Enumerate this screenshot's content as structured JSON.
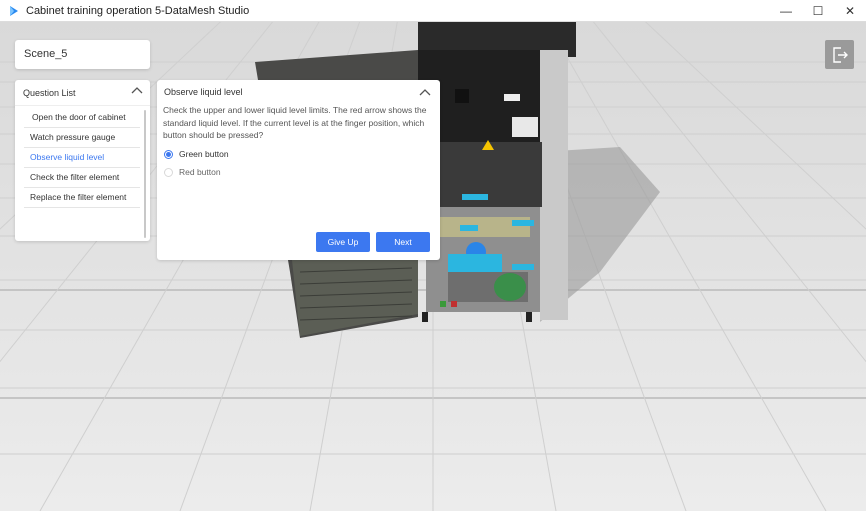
{
  "window": {
    "title": "Cabinet training operation 5-DataMesh Studio",
    "controls": [
      "minimize",
      "maximize",
      "close"
    ],
    "control_glyphs": {
      "minimize": "—",
      "maximize": "☐",
      "close": "✕"
    }
  },
  "scene": {
    "name": "Scene_5"
  },
  "question_list": {
    "title": "Question List",
    "items": [
      {
        "label": "Open the door of cabinet",
        "active": false
      },
      {
        "label": "Watch pressure gauge",
        "active": false
      },
      {
        "label": "Observe liquid level",
        "active": true
      },
      {
        "label": "Check the filter element",
        "active": false
      },
      {
        "label": "Replace the filter element",
        "active": false
      }
    ]
  },
  "question": {
    "title": "Observe liquid level",
    "text": "Check the upper and lower liquid level limits. The red arrow shows the standard liquid level. If the current level is at the finger position, which button should be pressed?",
    "options": [
      {
        "label": "Green button",
        "selected": true
      },
      {
        "label": "Red button",
        "selected": false
      }
    ],
    "give_up_label": "Give Up",
    "next_label": "Next"
  },
  "colors": {
    "accent": "#3c78f0",
    "exit_button": "#9a9a9a",
    "app_icon": "#2a8af0"
  },
  "icons": {
    "app": "app-logo-icon",
    "exit": "exit-icon",
    "collapse": "chevron-up-icon"
  }
}
